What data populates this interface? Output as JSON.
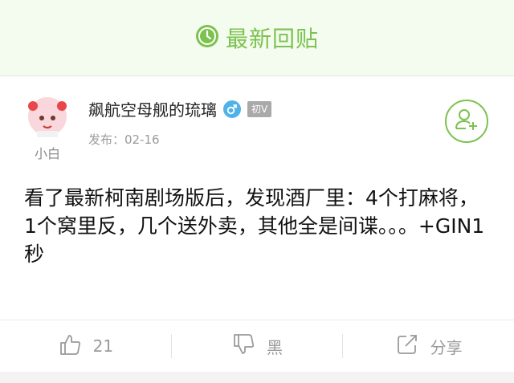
{
  "header": {
    "title": "最新回贴",
    "accent": "#7cc24e"
  },
  "post": {
    "author": {
      "name": "飙航空母舰的琉璃",
      "avatar_caption": "小白",
      "level": "初V",
      "gender": "male"
    },
    "publish_label": "发布：02-16",
    "content": "看了最新柯南剧场版后，发现酒厂里：4个打麻将，1个窝里反，几个送外卖，其他全是间谍。。。+GIN1秒"
  },
  "actions": {
    "like_count": "21",
    "dislike_label": "黑",
    "share_label": "分享"
  },
  "icons": [
    "clock-icon",
    "male-gender-icon",
    "add-user-icon",
    "thumbs-up-icon",
    "thumbs-down-icon",
    "share-icon"
  ]
}
